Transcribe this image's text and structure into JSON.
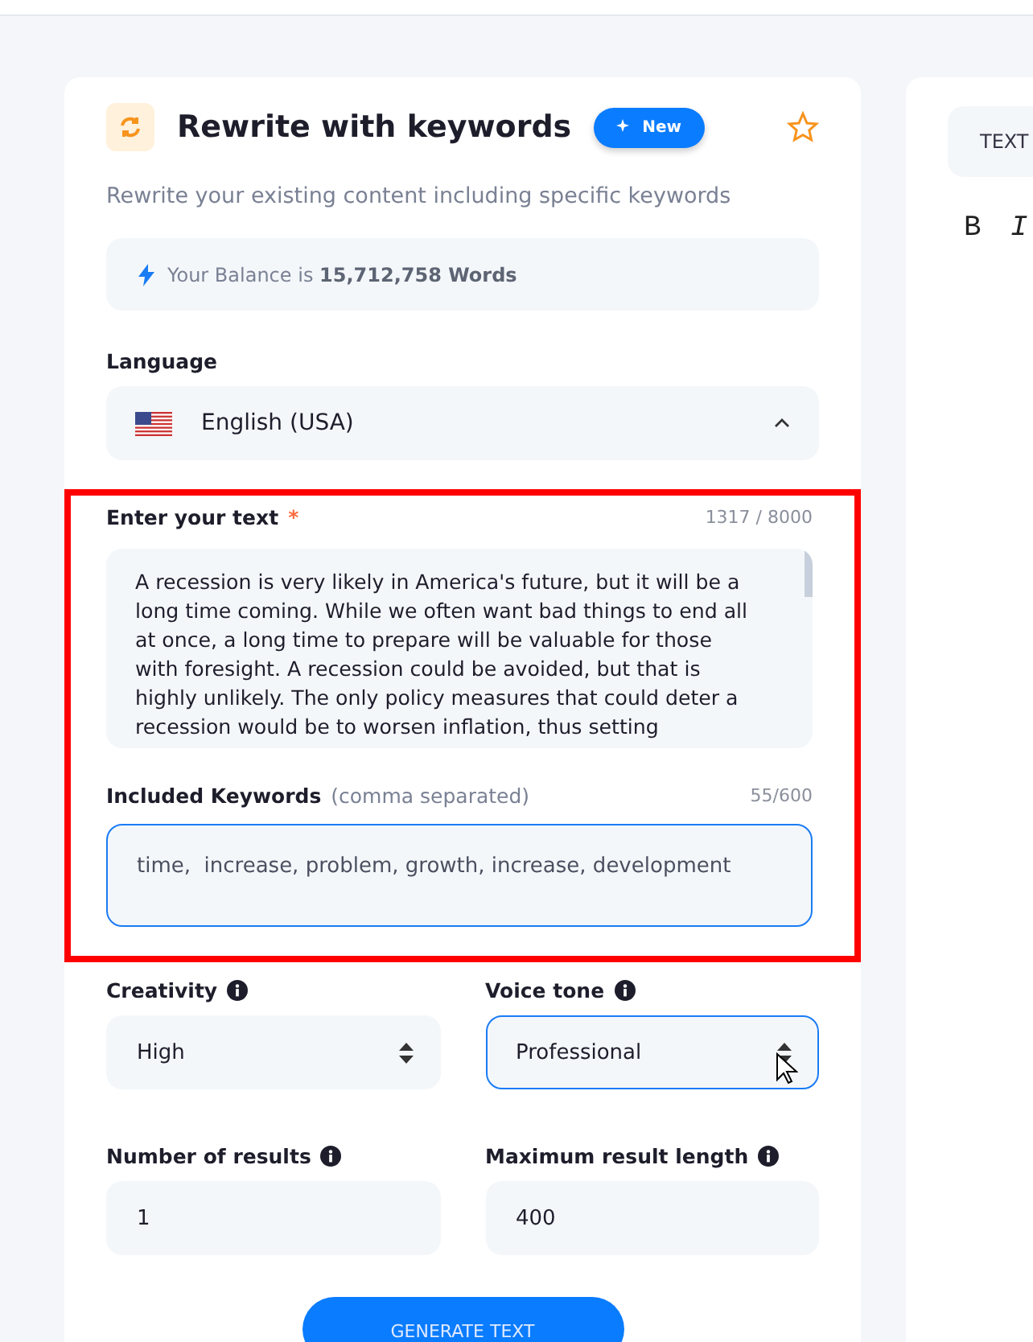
{
  "header": {
    "title": "Rewrite with keywords",
    "badge": "New",
    "favorited": false
  },
  "description": "Rewrite your existing content including specific keywords",
  "balance": {
    "text": "Your Balance is **15,712,758 Words**"
  },
  "language": {
    "label": "Language",
    "value": "English (USA)",
    "expanded": true
  },
  "text_input": {
    "label": "Enter your text",
    "required": "*",
    "counter": "1317 / 8000",
    "value": "A recession is very likely in America's future, but it will be a long time coming. While we often want bad things to end all at once, a long time to prepare will be valuable for those with foresight.  A recession could be avoided, but that is highly unlikely. The only policy measures that could deter a recession would be to worsen inflation, thus setting"
  },
  "keywords": {
    "label": "Included Keywords",
    "hint": "(comma separated)",
    "counter": "55/600",
    "value": "time,  increase, problem, growth, increase, development",
    "focused": true
  },
  "options": [
    {
      "label": "Creativity",
      "kind": "select",
      "value": "High",
      "focused": false
    },
    {
      "label": "Voice tone",
      "kind": "select",
      "value": "Professional",
      "focused": true
    },
    {
      "label": "Number of results",
      "kind": "input",
      "value": "1",
      "focused": false
    },
    {
      "label": "Maximum result length",
      "kind": "input",
      "value": "400",
      "focused": false
    }
  ],
  "generate_button": "GENERATE TEXT",
  "editor": {
    "tab": "TEXT",
    "toolbar": [
      "B",
      "I"
    ]
  }
}
